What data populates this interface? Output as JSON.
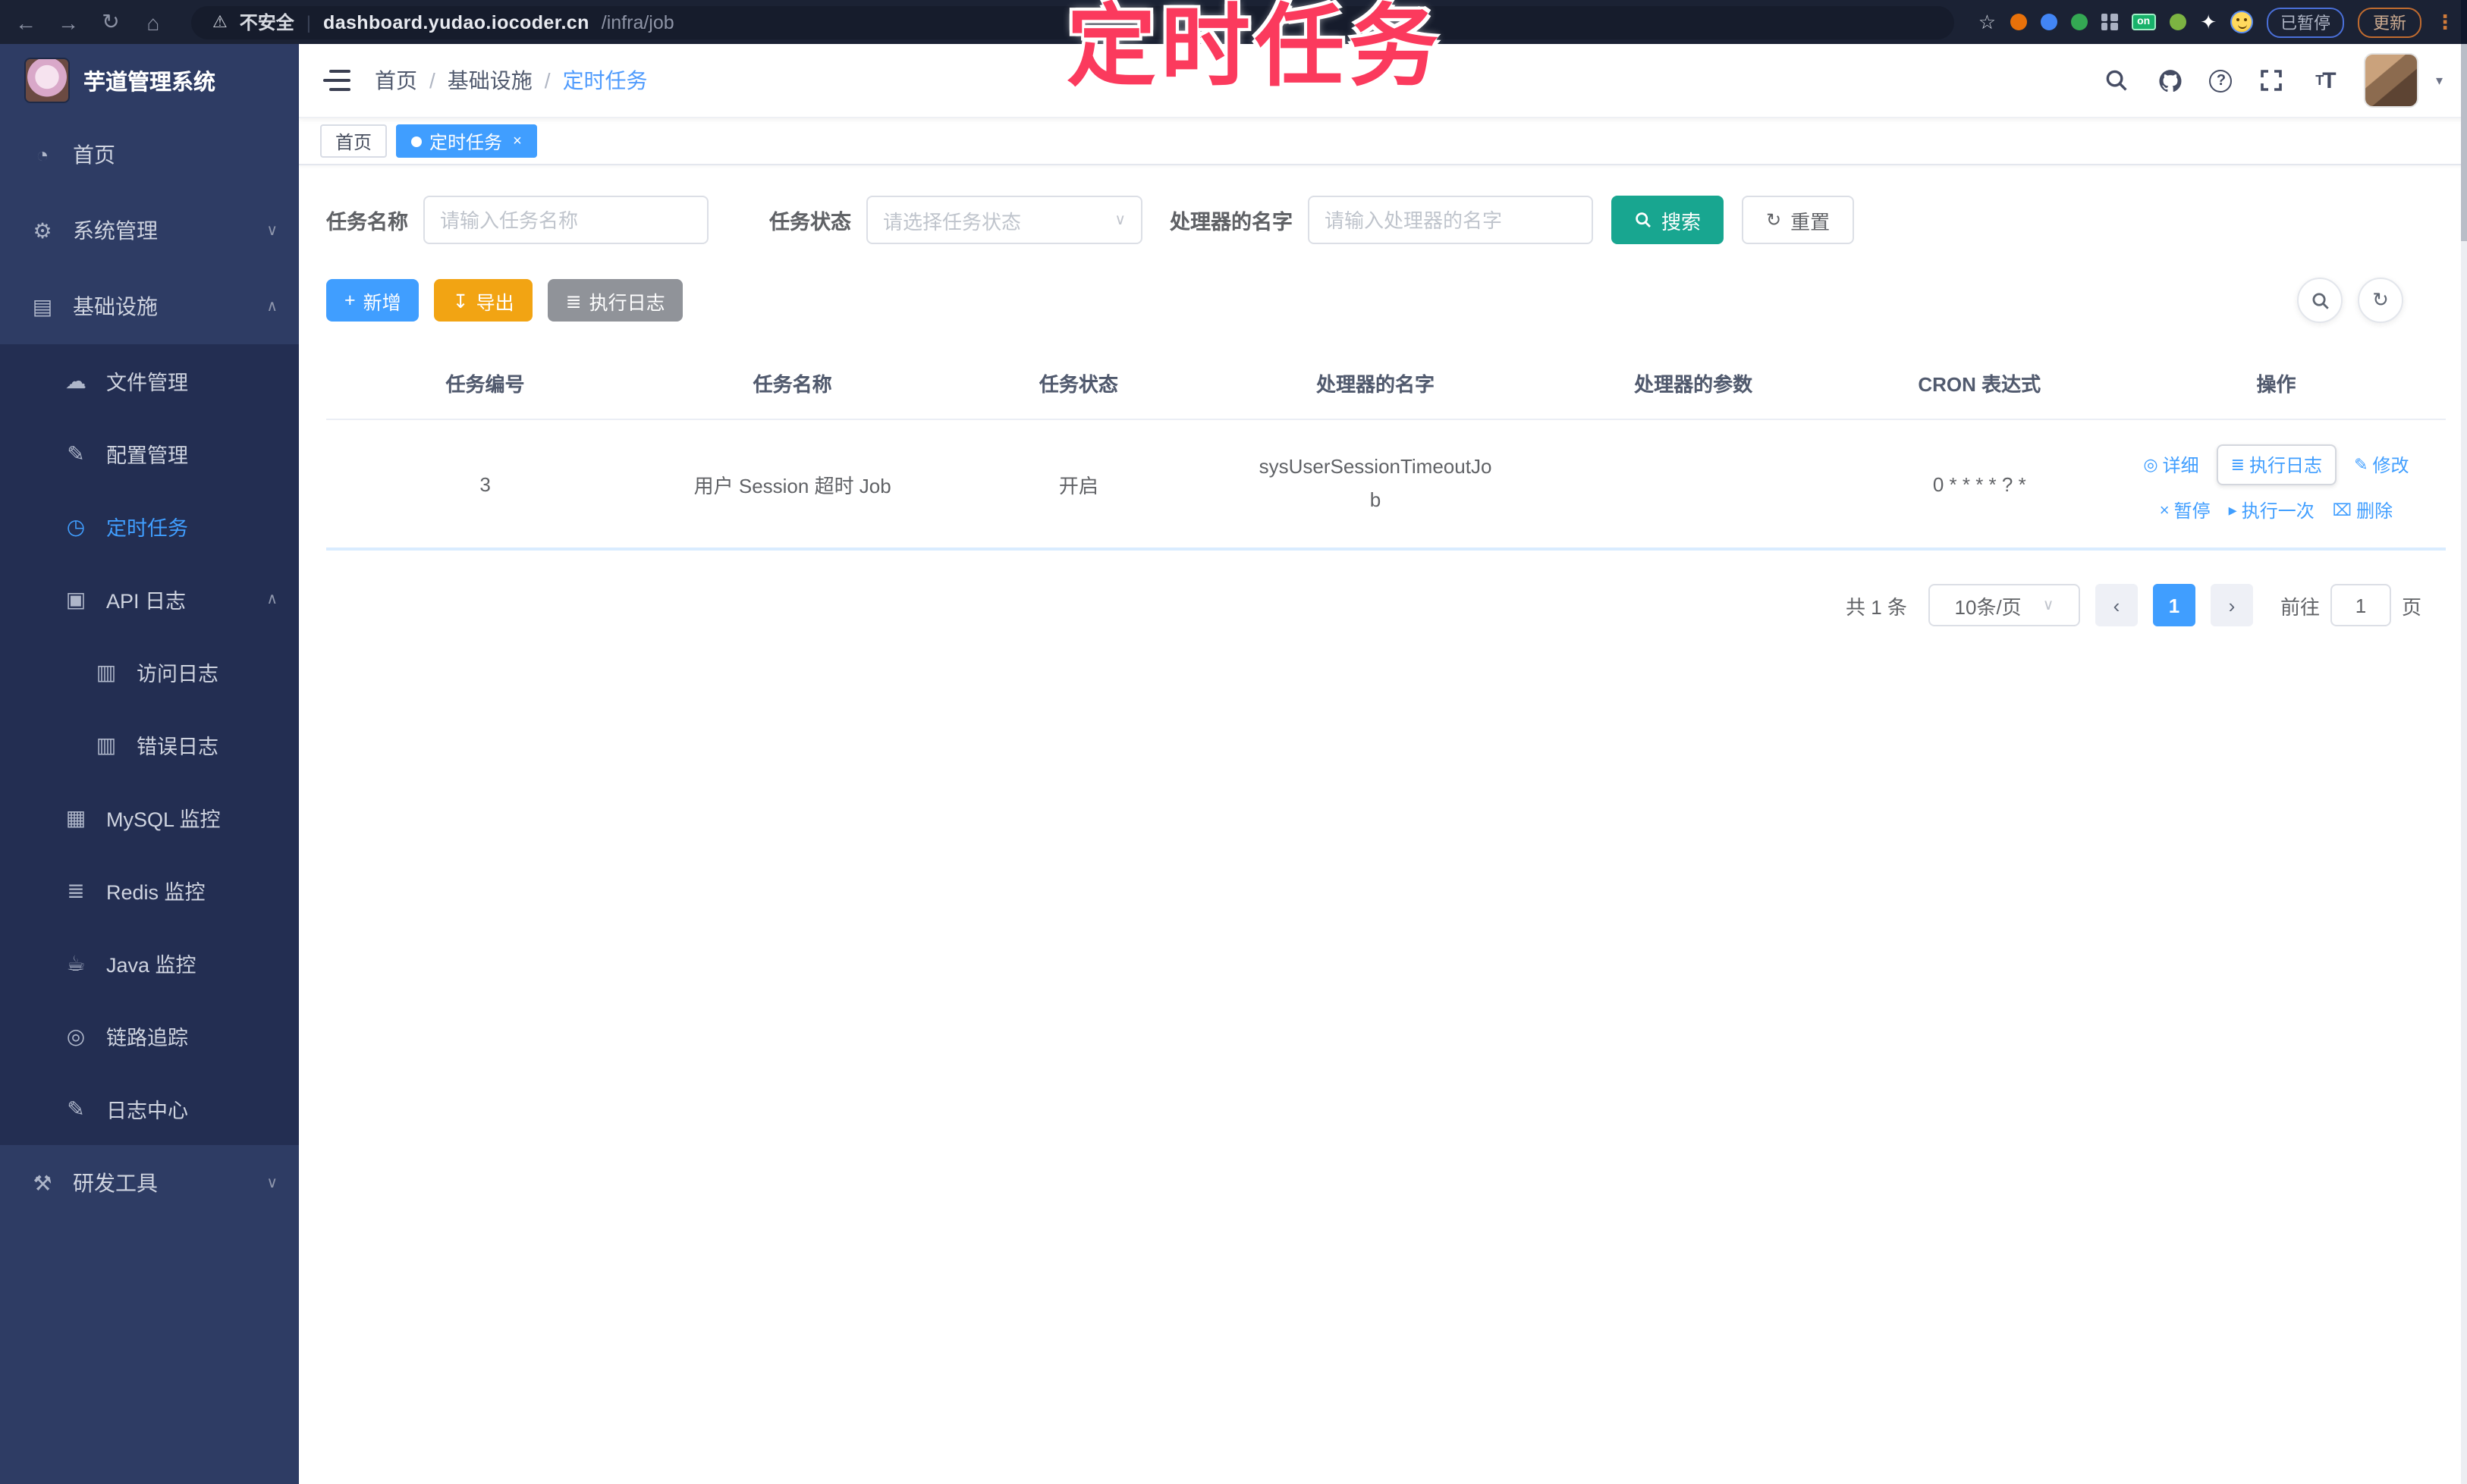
{
  "colors": {
    "accent": "#409eff",
    "watermark_pink": "#fb3a5d",
    "search_teal": "#18a690",
    "export_orange": "#f2a413",
    "sidebar_bg": "#2e3c64"
  },
  "browser": {
    "back": "←",
    "forward": "→",
    "reload": "↻",
    "home": "⌂",
    "warning_icon": "⚠",
    "security_text": "不安全",
    "url_domain": "dashboard.yudao.iocoder.cn",
    "url_path": "/infra/job",
    "star": "☆",
    "on_badge": "on",
    "paused_badge": "已暂停",
    "update_button": "更新",
    "menu_dots": "⋮"
  },
  "watermark": "定时任务",
  "sidebar": {
    "title": "芋道管理系统",
    "items": [
      {
        "icon": "◔",
        "label": "首页"
      },
      {
        "icon": "⚙",
        "label": "系统管理",
        "chevron": "∨"
      },
      {
        "icon": "▤",
        "label": "基础设施",
        "chevron": "∧"
      },
      {
        "icon": "☁",
        "label": "文件管理"
      },
      {
        "icon": "✎",
        "label": "配置管理"
      },
      {
        "icon": "◷",
        "label": "定时任务"
      },
      {
        "icon": "▣",
        "label": "API 日志",
        "chevron": "∧"
      },
      {
        "icon": "▥",
        "label": "访问日志"
      },
      {
        "icon": "▥",
        "label": "错误日志"
      },
      {
        "icon": "▦",
        "label": "MySQL 监控"
      },
      {
        "icon": "≣",
        "label": "Redis 监控"
      },
      {
        "icon": "☕",
        "label": "Java 监控"
      },
      {
        "icon": "◎",
        "label": "链路追踪"
      },
      {
        "icon": "✎",
        "label": "日志中心"
      },
      {
        "icon": "⚒",
        "label": "研发工具",
        "chevron": "∨"
      }
    ]
  },
  "navbar": {
    "breadcrumb": {
      "separator": "/",
      "items": [
        "首页",
        "基础设施",
        "定时任务"
      ]
    },
    "help_glyph": "?",
    "font_large": "T",
    "font_small": "T",
    "caret": "▾"
  },
  "tags": {
    "home": "首页",
    "active": "定时任务",
    "close": "×"
  },
  "form": {
    "name_label": "任务名称",
    "name_placeholder": "请输入任务名称",
    "status_label": "任务状态",
    "status_placeholder": "请选择任务状态",
    "handler_label": "处理器的名字",
    "handler_placeholder": "请输入处理器的名字",
    "search_label": "搜索",
    "reset_label": "重置",
    "reset_icon": "↻",
    "select_chevron": "∨"
  },
  "toolbar": {
    "add_label": "新增",
    "add_icon": "+",
    "export_label": "导出",
    "export_icon": "↧",
    "log_label": "执行日志",
    "log_icon": "≣",
    "refresh_icon": "↻"
  },
  "table": {
    "headers": [
      "任务编号",
      "任务名称",
      "任务状态",
      "处理器的名字",
      "处理器的参数",
      "CRON 表达式",
      "操作"
    ],
    "row": {
      "id": "3",
      "name": "用户 Session 超时 Job",
      "status": "开启",
      "handler": "sysUserSessionTimeoutJob",
      "param": "",
      "cron": "0 * * * * ? *"
    },
    "ops": [
      {
        "icon": "◎",
        "label": "详细"
      },
      {
        "icon": "≣",
        "label": "执行日志"
      },
      {
        "icon": "✎",
        "label": "修改"
      },
      {
        "icon": "×",
        "label": "暂停"
      },
      {
        "icon": "▸",
        "label": "执行一次"
      },
      {
        "icon": "⌧",
        "label": "删除"
      }
    ]
  },
  "pagination": {
    "total": "共 1 条",
    "size": "10条/页",
    "chevron": "∨",
    "prev": "‹",
    "next": "›",
    "page": "1",
    "goto_label": "前往",
    "goto_value": "1",
    "page_suffix": "页"
  }
}
